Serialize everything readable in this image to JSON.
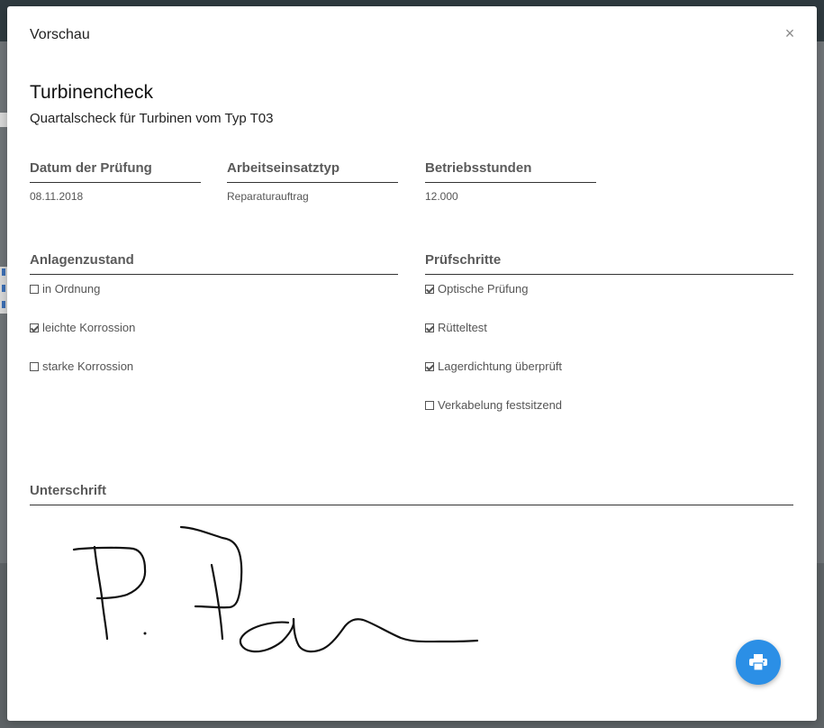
{
  "modal": {
    "title": "Vorschau",
    "close_label": "×"
  },
  "document": {
    "title": "Turbinencheck",
    "subtitle": "Quartalscheck für Turbinen vom Typ T03"
  },
  "fields": [
    {
      "label": "Datum der Prüfung",
      "value": "08.11.2018"
    },
    {
      "label": "Arbeitseinsatztyp",
      "value": "Reparaturauftrag"
    },
    {
      "label": "Betriebsstunden",
      "value": "12.000"
    }
  ],
  "anlagenzustand": {
    "label": "Anlagenzustand",
    "items": [
      {
        "label": "in Ordnung",
        "checked": false
      },
      {
        "label": "leichte Korrossion",
        "checked": true
      },
      {
        "label": "starke Korrossion",
        "checked": false
      }
    ]
  },
  "pruefschritte": {
    "label": "Prüfschritte",
    "items": [
      {
        "label": "Optische Prüfung",
        "checked": true
      },
      {
        "label": "Rütteltest",
        "checked": true
      },
      {
        "label": "Lagerdichtung überprüft",
        "checked": true
      },
      {
        "label": "Verkabelung festsitzend",
        "checked": false
      }
    ]
  },
  "signature": {
    "label": "Unterschrift",
    "image": "handwritten-signature"
  },
  "print_button": {
    "icon": "printer-icon"
  },
  "colors": {
    "accent": "#2b8fe6",
    "label": "#5a5a5a"
  }
}
